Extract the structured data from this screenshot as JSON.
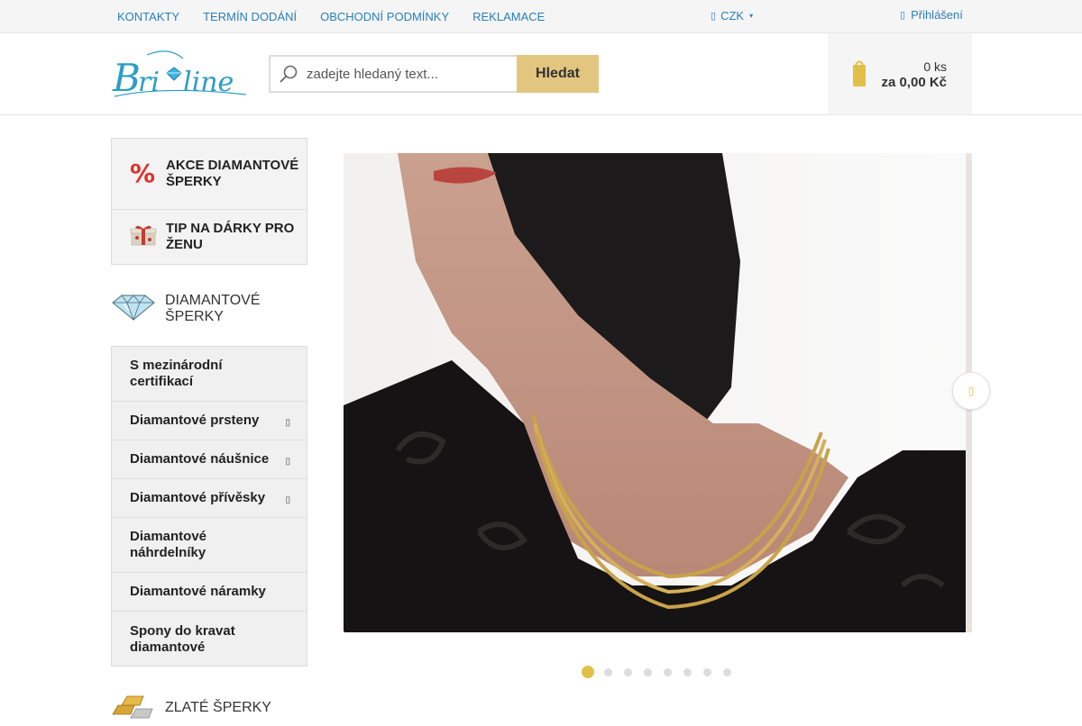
{
  "topbar": {
    "links": [
      "KONTAKTY",
      "TERMÍN DODÁNÍ",
      "OBCHODNÍ PODMÍNKY",
      "REKLAMACE"
    ],
    "currency": "CZK",
    "login": "Přihlášení"
  },
  "header": {
    "logo_text": "Briline",
    "search": {
      "placeholder": "zadejte hledaný text...",
      "button": "Hledat"
    },
    "cart": {
      "count": "0 ks",
      "total": "za 0,00 Kč"
    }
  },
  "sidebar": {
    "promos": [
      {
        "label": "Akce diamantové šperky",
        "icon": "percent-icon"
      },
      {
        "label": "Tip na dárky pro ženu",
        "icon": "gift-icon"
      }
    ],
    "category_diamond": {
      "label": "Diamantové šperky",
      "icon": "diamond-icon"
    },
    "menu": [
      {
        "label": "S mezinárodní certifikací",
        "has_submenu": false
      },
      {
        "label": "Diamantové prsteny",
        "has_submenu": true
      },
      {
        "label": "Diamantové náušnice",
        "has_submenu": true
      },
      {
        "label": "Diamantové přívěsky",
        "has_submenu": true
      },
      {
        "label": "Diamantové náhrdelníky",
        "has_submenu": false
      },
      {
        "label": "Diamantové náramky",
        "has_submenu": false
      },
      {
        "label": "Spony do kravat diamantové",
        "has_submenu": false
      }
    ],
    "category_gold": {
      "label": "Zlaté šperky",
      "icon": "gold-bars-icon"
    }
  },
  "slider": {
    "image": "woman-wearing-gold-necklaces",
    "total_slides": 8,
    "active_slide": 1
  },
  "colors": {
    "accent_gold": "#e2c680",
    "link_blue": "#2a7fb8",
    "dot_active": "#e2c047"
  }
}
